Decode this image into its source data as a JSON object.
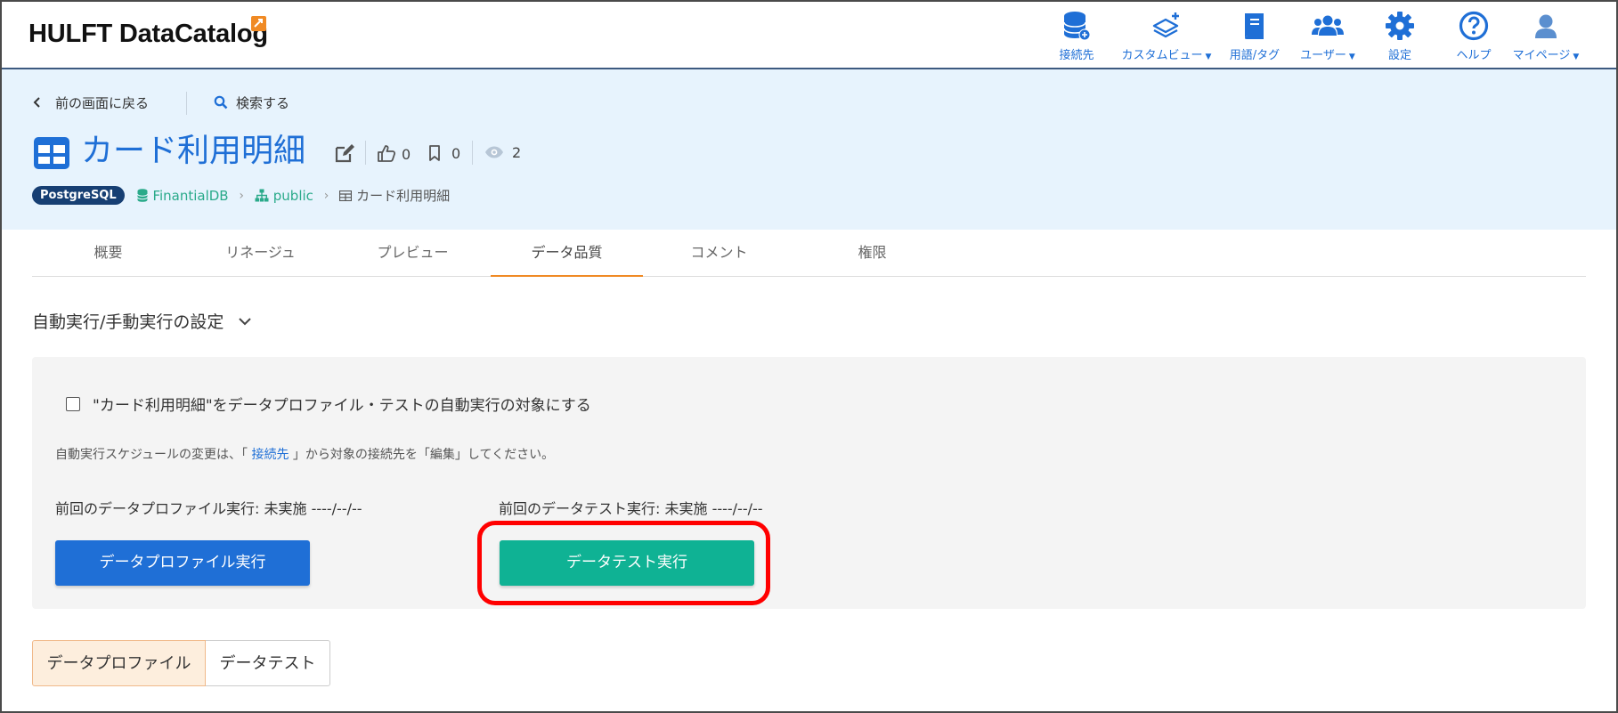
{
  "app": {
    "logo_text": "HULFT DataCatalog"
  },
  "nav": {
    "items": [
      {
        "label": "接続先",
        "icon": "database-plus-icon",
        "has_caret": false
      },
      {
        "label": "カスタムビュー",
        "icon": "layers-plus-icon",
        "has_caret": true
      },
      {
        "label": "用語/タグ",
        "icon": "glossary-book-icon",
        "has_caret": false
      },
      {
        "label": "ユーザー",
        "icon": "users-icon",
        "has_caret": true
      },
      {
        "label": "設定",
        "icon": "gear-icon",
        "has_caret": false
      },
      {
        "label": "ヘルプ",
        "icon": "help-circle-icon",
        "has_caret": false
      },
      {
        "label": "マイページ",
        "icon": "user-icon",
        "has_caret": true
      }
    ]
  },
  "object_header": {
    "back_label": "前の画面に戻る",
    "search_label": "検索する",
    "title": "カード利用明細",
    "like_count": "0",
    "bookmark_count": "0",
    "view_count": "2",
    "breadcrumb": {
      "badge": "PostgreSQL",
      "database": "FinantialDB",
      "schema": "public",
      "table": "カード利用明細"
    }
  },
  "tabs": [
    {
      "label": "概要",
      "active": false
    },
    {
      "label": "リネージュ",
      "active": false
    },
    {
      "label": "プレビュー",
      "active": false
    },
    {
      "label": "データ品質",
      "active": true
    },
    {
      "label": "コメント",
      "active": false
    },
    {
      "label": "権限",
      "active": false
    }
  ],
  "settings": {
    "section_title": "自動実行/手動実行の設定",
    "checkbox_label": "\"カード利用明細\"をデータプロファイル・テストの自動実行の対象にする",
    "checkbox_checked": false,
    "note_prefix": "自動実行スケジュールの変更は、「 ",
    "note_link": "接続先",
    "note_suffix": " 」から対象の接続先を「編集」してください。",
    "last_profile_run": "前回のデータプロファイル実行: 未実施 ----/--/--",
    "last_test_run": "前回のデータテスト実行: 未実施 ----/--/--",
    "profile_button": "データプロファイル実行",
    "test_button": "データテスト実行"
  },
  "segmented": {
    "profile_label": "データプロファイル",
    "test_label": "データテスト",
    "selected": "データプロファイル"
  },
  "colors": {
    "brand_blue": "#1f6fd6",
    "teal": "#0fb294",
    "accent_orange": "#f08a24",
    "header_bg": "#e7f3fd",
    "highlight_red": "#ff0000"
  }
}
